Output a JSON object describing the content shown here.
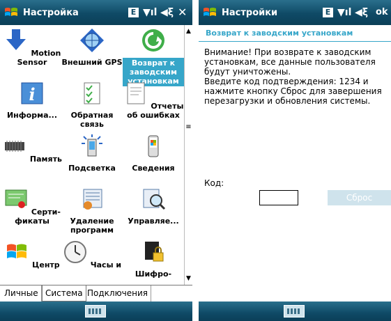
{
  "left": {
    "title": "Настройка",
    "status_e": "E",
    "grid": [
      {
        "label": "Motion Sensor",
        "icon": "motion-sensor-icon"
      },
      {
        "label": "Внешний GPS",
        "icon": "gps-icon"
      },
      {
        "label": "Возврат к заводским установкам",
        "icon": "factory-reset-icon",
        "selected": true
      },
      {
        "label": "Информа...",
        "icon": "info-icon"
      },
      {
        "label": "Обратная связь",
        "icon": "feedback-icon"
      },
      {
        "label": "Отчеты об ошибках",
        "icon": "error-report-icon"
      },
      {
        "label": "Память",
        "icon": "memory-icon"
      },
      {
        "label": "Подсветка",
        "icon": "backlight-icon"
      },
      {
        "label": "Сведения",
        "icon": "about-icon"
      },
      {
        "label": "Серти-фикаты",
        "icon": "certificates-icon"
      },
      {
        "label": "Удаление программ",
        "icon": "remove-programs-icon"
      },
      {
        "label": "Управляе...",
        "icon": "managed-icon"
      },
      {
        "label": "Центр",
        "icon": "windows-center-icon"
      },
      {
        "label": "Часы и",
        "icon": "clock-icon"
      },
      {
        "label": "Шифро-",
        "icon": "encryption-icon"
      }
    ],
    "tabs": [
      "Личные",
      "Система",
      "Подключения"
    ],
    "active_tab": "Система"
  },
  "right": {
    "title": "Настройки",
    "status_e": "E",
    "ok_label": "ok",
    "subheader": "Возврат к заводским установкам",
    "message_lines": [
      "Внимание! При возврате к заводским установкам, все данные пользователя будут уничтожены.",
      "Введите код подтверждения: 1234 и нажмите кнопку Сброс для завершения перезагрузки и обновления системы."
    ],
    "code_label": "Код:",
    "code_value": "",
    "reset_label": "Сброс"
  },
  "colors": {
    "title_bar": "#0f4a66",
    "accent": "#36a6c9",
    "disabled_button": "#cfe3ec"
  }
}
